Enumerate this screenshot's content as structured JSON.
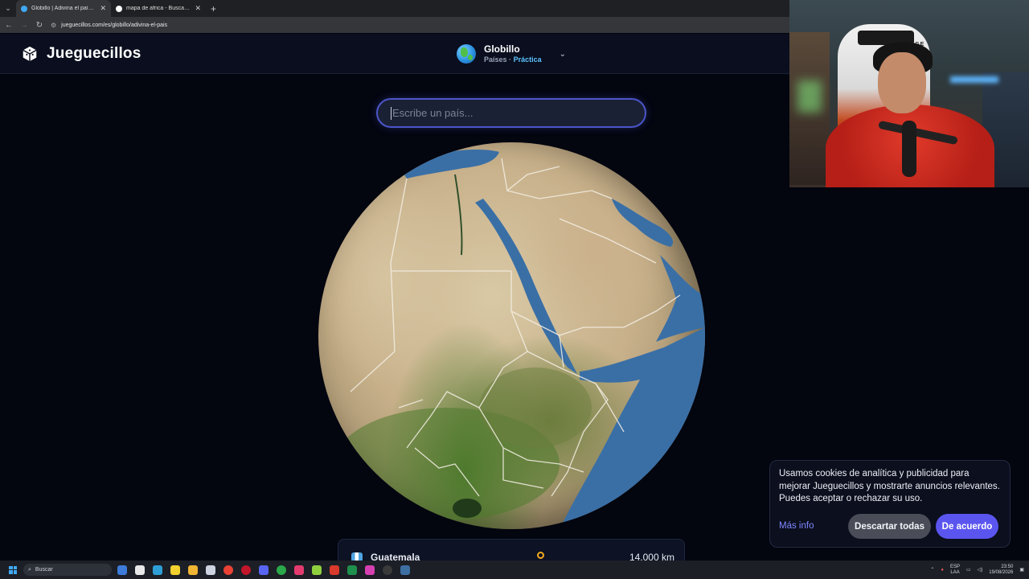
{
  "browser": {
    "tabs": [
      {
        "title": "Globillo | Adivina el país o la ci",
        "active": true,
        "favicon_color": "#3fa9f5"
      },
      {
        "title": "mapa de africa - Buscar con Go",
        "active": false,
        "favicon_color": "#ffffff"
      }
    ],
    "url": "jueguecillos.com/es/globillo/adivina-el-pais"
  },
  "header": {
    "logo_text": "Jueguecillos",
    "game_title": "Globillo",
    "game_mode": "Países",
    "game_separator": "·",
    "game_practice": "Práctica"
  },
  "search": {
    "placeholder": "Escribe un país..."
  },
  "result": {
    "country": "Guatemala",
    "distance": "14.000 km"
  },
  "cookie": {
    "text": "Usamos cookies de analítica y publicidad para mejorar Jueguecillos y mostrarte anuncios relevantes. Puedes aceptar o rechazar su uso.",
    "more_label": "Más info",
    "reject_label": "Descartar todas",
    "accept_label": "De acuerdo"
  },
  "webcam": {
    "chair_brand": "VERTAGE"
  },
  "taskbar": {
    "search_label": "Buscar",
    "lang_top": "ESP",
    "lang_bottom": "LAA",
    "time": "23:50",
    "date": "19/08/2026"
  },
  "colors": {
    "accent": "#5b55f0",
    "link": "#7f87ff",
    "practice": "#5cc3ff",
    "sea": "#3a6fa6"
  }
}
